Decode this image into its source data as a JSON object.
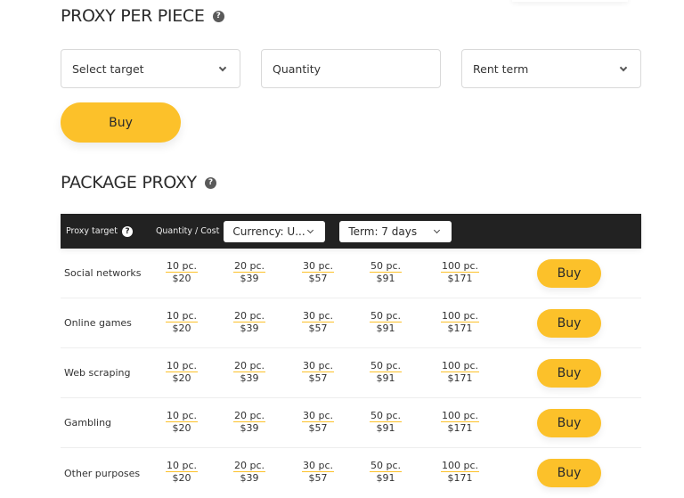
{
  "per_piece": {
    "title": "PROXY PER PIECE",
    "help_icon": "?",
    "target_select": {
      "label": "Select target"
    },
    "quantity_input": {
      "placeholder": "Quantity"
    },
    "term_select": {
      "label": "Rent term"
    },
    "buy_label": "Buy"
  },
  "package": {
    "title": "PACKAGE PROXY",
    "help_icon": "?",
    "header": {
      "target_label": "Proxy target",
      "target_help": "?",
      "qty_cost_label": "Quantity / Cost",
      "currency_select": "Currency: U...",
      "term_select": "Term: 7 days"
    },
    "rows": [
      {
        "label": "Social networks",
        "packages": [
          {
            "qty": "10 pc.",
            "price": "$20"
          },
          {
            "qty": "20 pc.",
            "price": "$39"
          },
          {
            "qty": "30 pc.",
            "price": "$57"
          },
          {
            "qty": "50 pc.",
            "price": "$91"
          },
          {
            "qty": "100 pc.",
            "price": "$171"
          }
        ],
        "buy_label": "Buy"
      },
      {
        "label": "Online games",
        "packages": [
          {
            "qty": "10 pc.",
            "price": "$20"
          },
          {
            "qty": "20 pc.",
            "price": "$39"
          },
          {
            "qty": "30 pc.",
            "price": "$57"
          },
          {
            "qty": "50 pc.",
            "price": "$91"
          },
          {
            "qty": "100 pc.",
            "price": "$171"
          }
        ],
        "buy_label": "Buy"
      },
      {
        "label": "Web scraping",
        "packages": [
          {
            "qty": "10 pc.",
            "price": "$20"
          },
          {
            "qty": "20 pc.",
            "price": "$39"
          },
          {
            "qty": "30 pc.",
            "price": "$57"
          },
          {
            "qty": "50 pc.",
            "price": "$91"
          },
          {
            "qty": "100 pc.",
            "price": "$171"
          }
        ],
        "buy_label": "Buy"
      },
      {
        "label": "Gambling",
        "packages": [
          {
            "qty": "10 pc.",
            "price": "$20"
          },
          {
            "qty": "20 pc.",
            "price": "$39"
          },
          {
            "qty": "30 pc.",
            "price": "$57"
          },
          {
            "qty": "50 pc.",
            "price": "$91"
          },
          {
            "qty": "100 pc.",
            "price": "$171"
          }
        ],
        "buy_label": "Buy"
      },
      {
        "label": "Other purposes",
        "packages": [
          {
            "qty": "10 pc.",
            "price": "$20"
          },
          {
            "qty": "20 pc.",
            "price": "$39"
          },
          {
            "qty": "30 pc.",
            "price": "$57"
          },
          {
            "qty": "50 pc.",
            "price": "$91"
          },
          {
            "qty": "100 pc.",
            "price": "$171"
          }
        ],
        "buy_label": "Buy"
      }
    ]
  },
  "colors": {
    "accent": "#fcc12a",
    "header_bg": "#222222",
    "text": "#333333"
  }
}
